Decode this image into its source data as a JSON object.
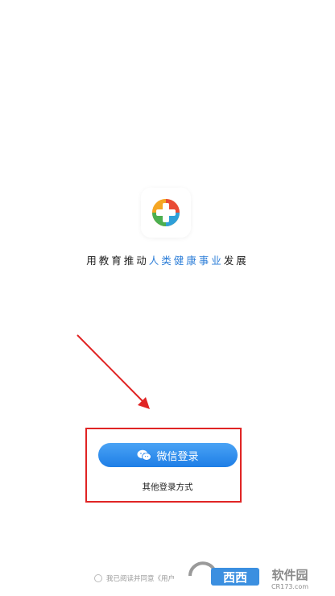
{
  "slogan": {
    "prefix": "用教育推动",
    "highlight": "人类健康事业",
    "suffix": "发展"
  },
  "login": {
    "wechat_label": "微信登录",
    "other_label": "其他登录方式"
  },
  "agreement": {
    "text": "我已阅读并同意《用户"
  },
  "watermark": {
    "brand": "西西软件园",
    "url": "CR173.com"
  },
  "colors": {
    "accent": "#2f7fd8",
    "button_top": "#4aa3f5",
    "button_bottom": "#1e7ee6",
    "annotation_red": "#e02424"
  }
}
